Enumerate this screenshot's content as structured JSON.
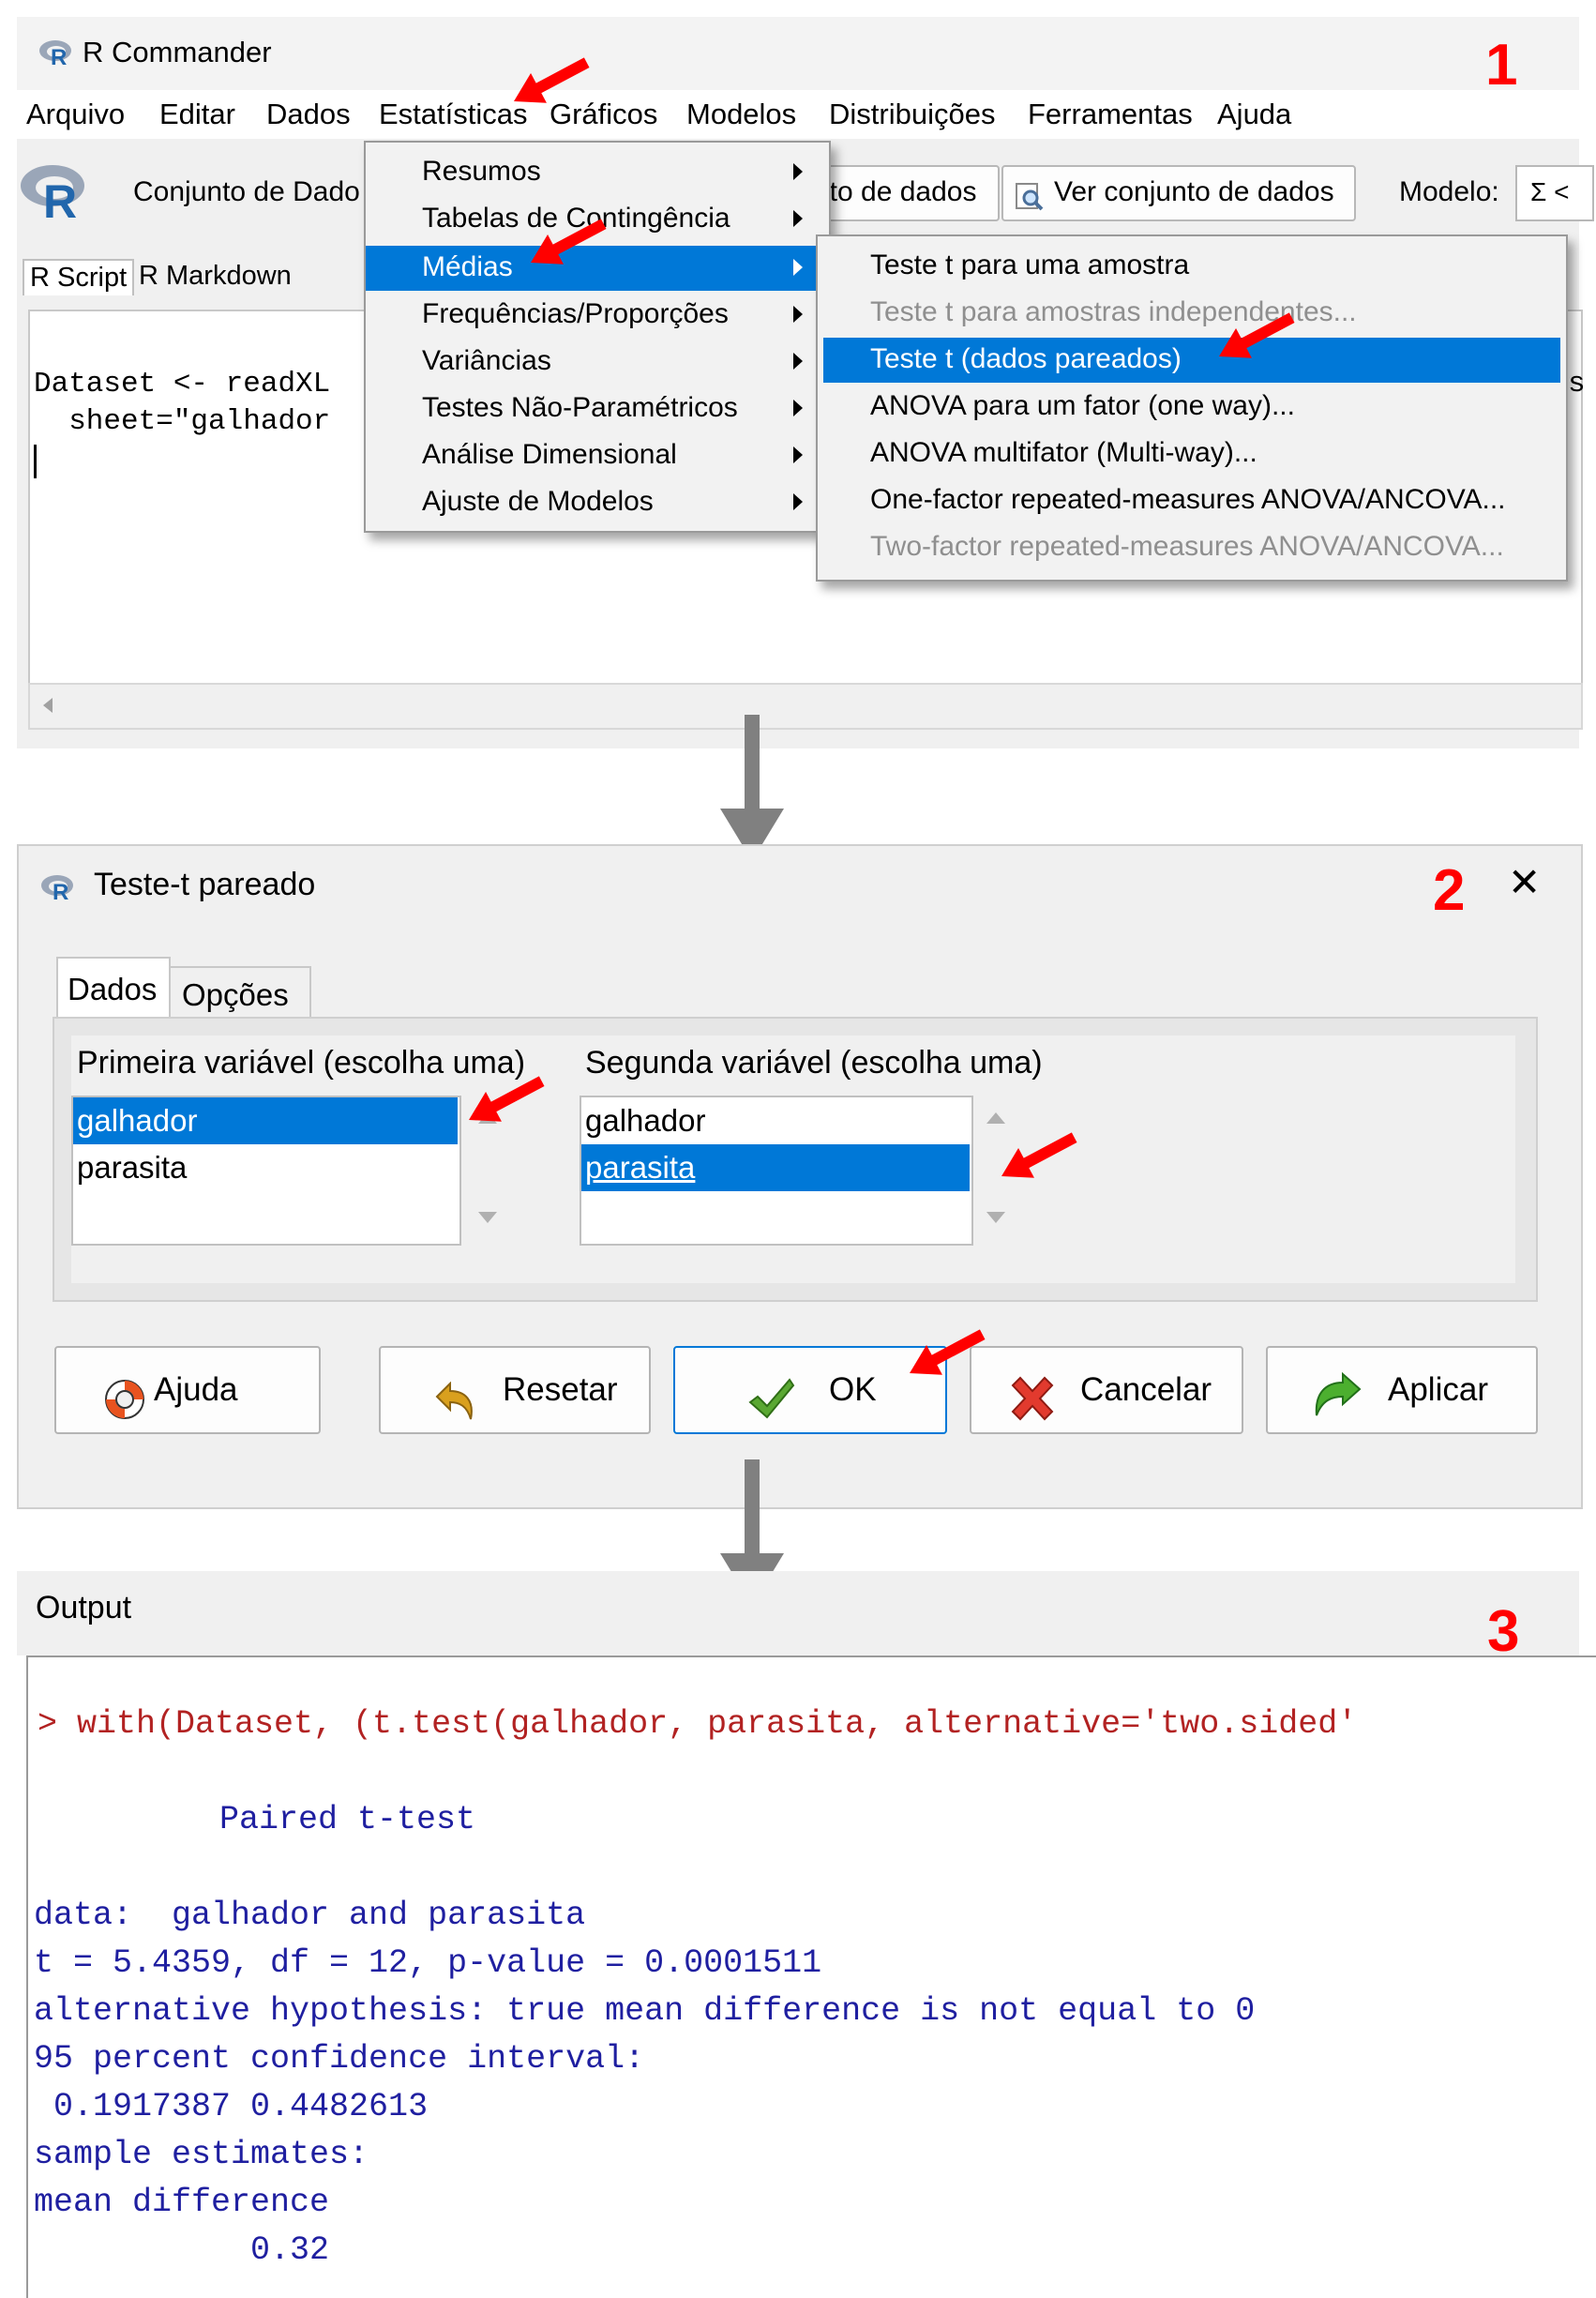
{
  "window": {
    "title": "R Commander"
  },
  "menubar": [
    "Arquivo",
    "Editar",
    "Dados",
    "Estatísticas",
    "Gráficos",
    "Modelos",
    "Distribuições",
    "Ferramentas",
    "Ajuda"
  ],
  "toolbar": {
    "dataset_label": "Conjunto de Dado",
    "edit_dataset_fragment": "nto de dados",
    "view_dataset": "Ver conjunto de dados",
    "model_label": "Modelo:",
    "model_value": "Σ <"
  },
  "tabs": [
    "R Script",
    "R Markdown"
  ],
  "editor": {
    "line1": "Dataset <- readXL",
    "line2": "  sheet=\"galhador",
    "right_fragment": "s"
  },
  "stats_menu": {
    "items": [
      "Resumos",
      "Tabelas de Contingência",
      "Médias",
      "Frequências/Proporções",
      "Variâncias",
      "Testes Não-Paramétricos",
      "Análise Dimensional",
      "Ajuste de Modelos"
    ],
    "selected_index": 2
  },
  "means_menu": {
    "items": [
      "Teste t para uma amostra",
      "Teste t para amostras independentes...",
      "Teste t  (dados pareados)",
      "ANOVA para um fator (one way)...",
      "ANOVA multifator (Multi-way)...",
      "One-factor repeated-measures ANOVA/ANCOVA...",
      "Two-factor repeated-measures ANOVA/ANCOVA..."
    ],
    "selected_index": 2,
    "disabled_indices": [
      1,
      6
    ]
  },
  "dialog": {
    "title": "Teste-t pareado",
    "tabs": [
      "Dados",
      "Opções"
    ],
    "first_label": "Primeira variável (escolha uma)",
    "second_label": "Segunda variável (escolha uma)",
    "first_items": [
      "galhador",
      "parasita"
    ],
    "second_items": [
      "galhador",
      "parasita"
    ],
    "first_selected": "galhador",
    "second_selected": "parasita",
    "buttons": {
      "help": "Ajuda",
      "reset": "Resetar",
      "ok": "OK",
      "cancel": "Cancelar",
      "apply": "Aplicar"
    },
    "close": "✕"
  },
  "output": {
    "header": "Output",
    "command": "> with(Dataset, (t.test(galhador, parasita, alternative='two.sided'",
    "test_name": "Paired t-test",
    "data_line": "data:  galhador and parasita",
    "stat_line": "t = 5.4359, df = 12, p-value = 0.0001511",
    "alt_line": "alternative hypothesis: true mean difference is not equal to 0",
    "ci_label": "95 percent confidence interval:",
    "ci_values": " 0.1917387 0.4482613",
    "est_label": "sample estimates:",
    "est_name": "mean difference",
    "est_value": "           0.32"
  },
  "steps": [
    "1",
    "2",
    "3"
  ],
  "colors": {
    "selection": "#0078d7",
    "annotation": "#ff0000",
    "output_text": "#1f1fa0",
    "command_text": "#b22222",
    "flow_arrow": "#808080"
  }
}
